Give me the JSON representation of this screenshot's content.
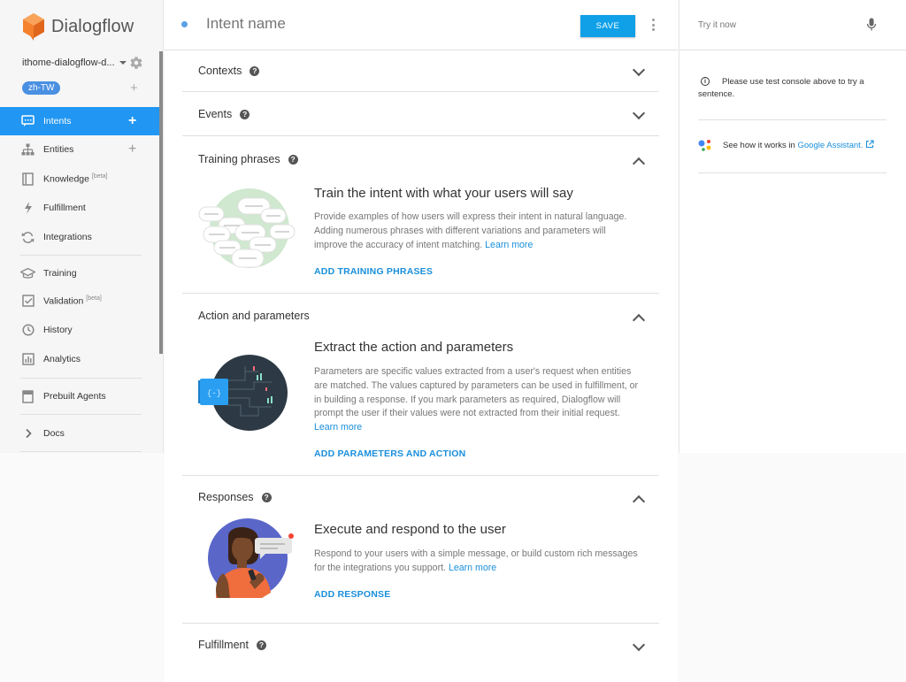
{
  "app": {
    "name": "Dialogflow",
    "brand_color": "#f5812c",
    "accent_color": "#2196f3"
  },
  "sidebar": {
    "agent_name": "ithome-dialogflow-d...",
    "language": "zh-TW",
    "items": [
      {
        "label": "Intents",
        "icon": "chat-icon",
        "active": true,
        "add": true
      },
      {
        "label": "Entities",
        "icon": "hierarchy-icon",
        "add": true
      },
      {
        "label": "Knowledge",
        "sup": "[beta]",
        "icon": "book-icon"
      },
      {
        "label": "Fulfillment",
        "icon": "bolt-icon"
      },
      {
        "label": "Integrations",
        "icon": "sync-icon"
      },
      {
        "label": "Training",
        "icon": "graduation-cap-icon"
      },
      {
        "label": "Validation",
        "sup": "[beta]",
        "icon": "checkbox-icon"
      },
      {
        "label": "History",
        "icon": "clock-icon"
      },
      {
        "label": "Analytics",
        "icon": "bar-chart-icon"
      },
      {
        "label": "Prebuilt Agents",
        "icon": "agents-book-icon"
      },
      {
        "label": "Docs",
        "icon": "chevron-right-icon"
      }
    ]
  },
  "header": {
    "intent_name_placeholder": "Intent name",
    "save_label": "SAVE"
  },
  "sections": {
    "contexts": {
      "title": "Contexts"
    },
    "events": {
      "title": "Events"
    },
    "training": {
      "title": "Training phrases",
      "heading": "Train the intent with what your users will say",
      "desc": "Provide examples of how users will express their intent in natural language. Adding numerous phrases with different variations and parameters will improve the accuracy of intent matching.",
      "learn_more": "Learn more",
      "action": "ADD TRAINING PHRASES"
    },
    "action_params": {
      "title": "Action and parameters",
      "heading": "Extract the action and parameters",
      "desc": "Parameters are specific values extracted from a user's request when entities are matched. The values captured by parameters can be used in fulfillment, or in building a response. If you mark parameters as required, Dialogflow will prompt the user if their values were not extracted from their initial request.",
      "learn_more": "Learn more",
      "action": "ADD PARAMETERS AND ACTION"
    },
    "responses": {
      "title": "Responses",
      "heading": "Execute and respond to the user",
      "desc": "Respond to your users with a simple message, or build custom rich messages for the integrations you support.",
      "learn_more": "Learn more",
      "action": "ADD RESPONSE"
    },
    "fulfillment": {
      "title": "Fulfillment"
    }
  },
  "right_panel": {
    "try_placeholder": "Try it now",
    "info_text": "Please use test console above to try a sentence.",
    "ga_prefix": "See how it works in",
    "ga_link": "Google Assistant."
  }
}
